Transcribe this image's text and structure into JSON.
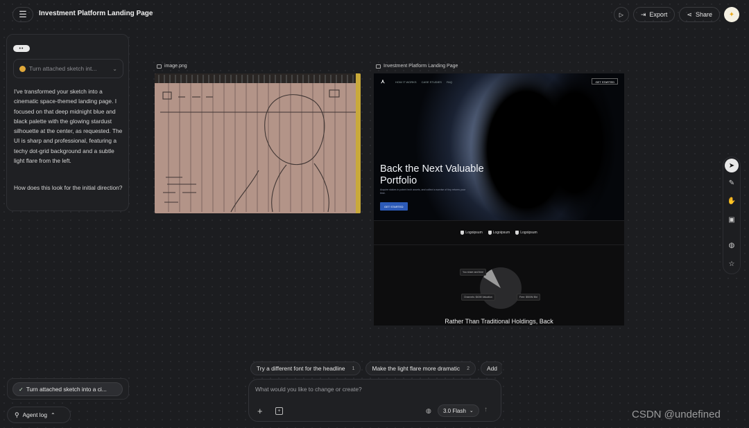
{
  "header": {
    "title": "Investment Platform Landing Page",
    "export_label": "Export",
    "share_label": "Share"
  },
  "chat": {
    "task_select": "Turn attached sketch int...",
    "message_1": "I've transformed your sketch into a cinematic space-themed landing page. I focused on that deep midnight blue and black palette with the glowing stardust silhouette at the center, as requested. The UI is sharp and professional, featuring a techy dot-grid background and a subtle light flare from the left.",
    "message_2": "How does this look for the initial direction?"
  },
  "canvas": {
    "image_label": "image.png",
    "preview_label": "Investment Platform Landing Page"
  },
  "preview": {
    "nav_links": [
      "HOW IT WORKS",
      "CASE STUDIES",
      "FAQ"
    ],
    "nav_cta": "GET STARTED",
    "hero_title": "Back the Next Valuable Portfolio",
    "hero_subtitle": "Acquire stakes in potent tech assets, and collect a sunrise of tiny returns your time.",
    "hero_cta": "GET STARTED",
    "logos": [
      "Logoipsum",
      "Logoipsum",
      "Logoipsum"
    ],
    "pie_tags": [
      "You share and time",
      "Channels: $40M Valuation",
      "Free: $500M Bid"
    ],
    "bottom_text": "Rather Than Traditional Holdings, Back"
  },
  "suggestions": [
    {
      "label": "Try a different font for the headline",
      "num": "1"
    },
    {
      "label": "Make the light flare more dramatic",
      "num": "2"
    },
    {
      "label": "Add",
      "num": ""
    }
  ],
  "composer": {
    "placeholder": "What would you like to change or create?",
    "model": "3.0 Flash"
  },
  "bottom_left": {
    "task_chip": "Turn attached sketch into a ci...",
    "agent_log": "Agent log"
  },
  "watermark": {
    "text": "CSDN @undefined"
  }
}
